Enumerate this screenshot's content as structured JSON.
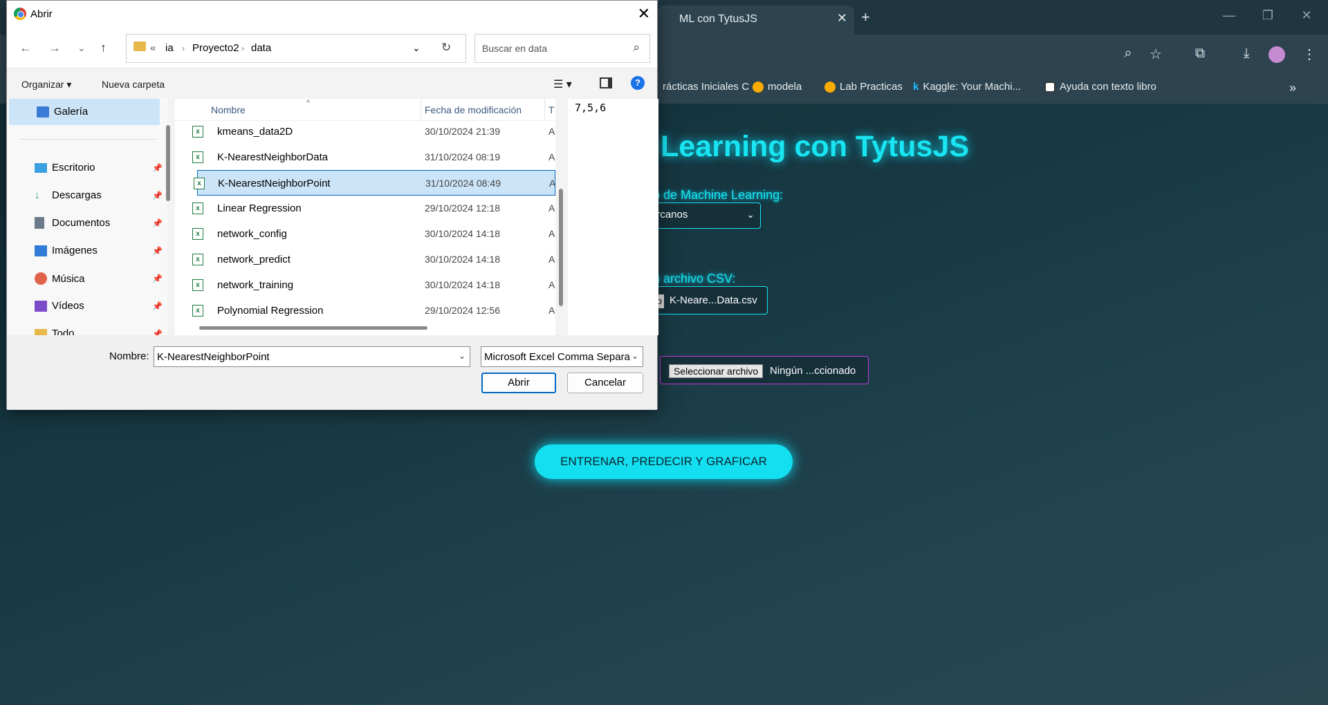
{
  "browser": {
    "tab_title": "ML con TytusJS",
    "bookmarks": [
      {
        "label": "rácticas Iniciales C",
        "icon": "bookmark-icon"
      },
      {
        "label": "modela",
        "icon": "colab-icon"
      },
      {
        "label": "Lab Practicas",
        "icon": "colab-icon"
      },
      {
        "label": "Kaggle: Your Machi...",
        "icon": "kaggle-icon"
      },
      {
        "label": "Ayuda con texto libro",
        "icon": "chatgpt-icon"
      }
    ]
  },
  "page": {
    "title": "Learning con TytusJS",
    "algo_label": "o de Machine Learning:",
    "algo_selected": "ercanos",
    "csv_label": "n archivo CSV:",
    "csv_button_stub": "o",
    "csv_file": "K-Neare...Data.csv",
    "point_button": "Seleccionar archivo",
    "point_file": "Ningún ...ccionado",
    "run_button": "ENTRENAR, PREDECIR Y GRAFICAR"
  },
  "dialog": {
    "title": "Abrir",
    "breadcrumb": [
      "«",
      "ia",
      "Proyecto2",
      "data"
    ],
    "search_placeholder": "Buscar en data",
    "organize": "Organizar",
    "new_folder": "Nueva carpeta",
    "nav_items": [
      {
        "label": "Galería",
        "icon": "gallery-icon",
        "color": "#3a7bd5"
      },
      {
        "label": "Escritorio",
        "icon": "desktop-icon",
        "color": "#3aa0e0"
      },
      {
        "label": "Descargas",
        "icon": "download-icon",
        "color": "#2a9d6b"
      },
      {
        "label": "Documentos",
        "icon": "documents-icon",
        "color": "#6b7b8c"
      },
      {
        "label": "Imágenes",
        "icon": "images-icon",
        "color": "#2f7bd6"
      },
      {
        "label": "Música",
        "icon": "music-icon",
        "color": "#e0634a"
      },
      {
        "label": "Vídeos",
        "icon": "videos-icon",
        "color": "#7b4bc9"
      },
      {
        "label": "Todo",
        "icon": "folder-icon",
        "color": "#e8b84a"
      }
    ],
    "columns": {
      "name": "Nombre",
      "date": "Fecha de modificación",
      "type": "T"
    },
    "files": [
      {
        "name": "kmeans_data2D",
        "date": "30/10/2024 21:39",
        "type": "A"
      },
      {
        "name": "K-NearestNeighborData",
        "date": "31/10/2024 08:19",
        "type": "A"
      },
      {
        "name": "K-NearestNeighborPoint",
        "date": "31/10/2024 08:49",
        "type": "A"
      },
      {
        "name": "Linear Regression",
        "date": "29/10/2024 12:18",
        "type": "A"
      },
      {
        "name": "network_config",
        "date": "30/10/2024 14:18",
        "type": "A"
      },
      {
        "name": "network_predict",
        "date": "30/10/2024 14:18",
        "type": "A"
      },
      {
        "name": "network_training",
        "date": "30/10/2024 14:18",
        "type": "A"
      },
      {
        "name": "Polynomial Regression",
        "date": "29/10/2024 12:56",
        "type": "A"
      }
    ],
    "preview": "7,5,6",
    "name_label": "Nombre:",
    "name_value": "K-NearestNeighborPoint",
    "file_type": "Microsoft Excel Comma Separa",
    "open_button": "Abrir",
    "cancel_button": "Cancelar"
  }
}
